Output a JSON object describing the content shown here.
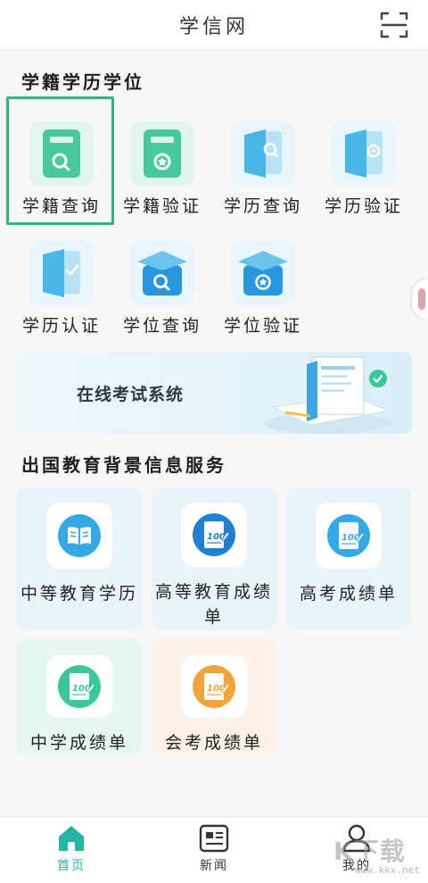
{
  "header": {
    "title": "学信网",
    "scan_icon": "scan-icon"
  },
  "section1": {
    "title": "学籍学历学位",
    "items": [
      {
        "label": "学籍查询",
        "icon": "book-search-icon"
      },
      {
        "label": "学籍验证",
        "icon": "book-verify-icon"
      },
      {
        "label": "学历查询",
        "icon": "booklet-search-icon"
      },
      {
        "label": "学历验证",
        "icon": "booklet-verify-icon"
      },
      {
        "label": "学历认证",
        "icon": "booklet-check-icon"
      },
      {
        "label": "学位查询",
        "icon": "cap-search-icon"
      },
      {
        "label": "学位验证",
        "icon": "cap-verify-icon"
      }
    ]
  },
  "banner": {
    "label": "在线考试系统"
  },
  "section2": {
    "title": "出国教育背景信息服务",
    "cards": [
      {
        "label": "中等教育学历",
        "icon": "open-book-icon"
      },
      {
        "label": "高等教育成绩单",
        "icon": "score-sheet-icon"
      },
      {
        "label": "高考成绩单",
        "icon": "score-sheet-icon"
      },
      {
        "label": "中学成绩单",
        "icon": "score-sheet-icon"
      },
      {
        "label": "会考成绩单",
        "icon": "score-sheet-icon"
      }
    ]
  },
  "tabbar": {
    "tabs": [
      {
        "label": "首页",
        "icon": "home-icon",
        "active": true
      },
      {
        "label": "新闻",
        "icon": "news-icon",
        "active": false
      },
      {
        "label": "我的",
        "icon": "user-icon",
        "active": false
      }
    ]
  },
  "watermark": {
    "main": "K下载",
    "sub": "www.kkx.net"
  },
  "colors": {
    "accent": "#24b5a5",
    "highlight_border": "#2fb67c",
    "blue": "#2a96de",
    "orange": "#f2a33a",
    "green": "#3cc79a"
  }
}
